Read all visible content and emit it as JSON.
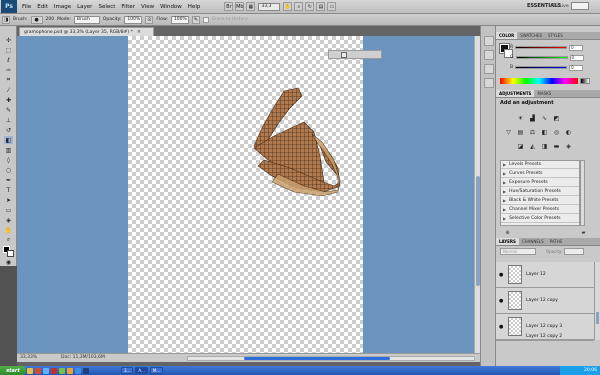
{
  "menubar": {
    "logo": "Ps",
    "items": [
      "File",
      "Edit",
      "Image",
      "Layer",
      "Select",
      "Filter",
      "View",
      "Window",
      "Help"
    ],
    "zoom": "33,3",
    "workspace": "ESSENTIALS",
    "cs_live": "CS Live"
  },
  "options": {
    "brush_label": "Brush:",
    "brush_size": "200",
    "mode_label": "Mode:",
    "mode_value": "Brush",
    "opacity_label": "Opacity:",
    "opacity_value": "100%",
    "flow_label": "Flow:",
    "flow_value": "100%",
    "to_history_label": "Erase to History"
  },
  "document": {
    "tab_title": "gramophone.psd @ 33,3% (Layer 35, RGB/8#) *",
    "tab_close": "×",
    "status_zoom": "33,33%",
    "status_doc": "Doc: 11,3M/103,6M"
  },
  "panels": {
    "color_tabs": [
      "COLOR",
      "SWATCHES",
      "STYLES"
    ],
    "color_channels": [
      {
        "label": "R",
        "value": "0"
      },
      {
        "label": "G",
        "value": "0"
      },
      {
        "label": "B",
        "value": "0"
      }
    ],
    "adjust_tabs": [
      "ADJUSTMENTS",
      "MASKS"
    ],
    "adjust_title": "Add an adjustment",
    "presets": [
      "Levels Presets",
      "Curves Presets",
      "Exposure Presets",
      "Hue/Saturation Presets",
      "Black & White Presets",
      "Channel Mixer Presets",
      "Selective Color Presets"
    ],
    "layer_tabs": [
      "LAYERS",
      "CHANNELS",
      "PATHS"
    ],
    "blend_mode": "Normal",
    "opacity_label": "Opacity:",
    "layers": [
      "Layer 12",
      "Layer 12 copy",
      "Layer 12 copy 3",
      "Layer 12 copy 2"
    ]
  },
  "taskbar": {
    "start": "start",
    "tasks": [
      "3...",
      "A...",
      "M..."
    ],
    "clock": "20:06"
  },
  "colors": {
    "canvas_bg": "#6a93be",
    "accent": "#2d6edb",
    "taskbar": "#2456b4"
  }
}
